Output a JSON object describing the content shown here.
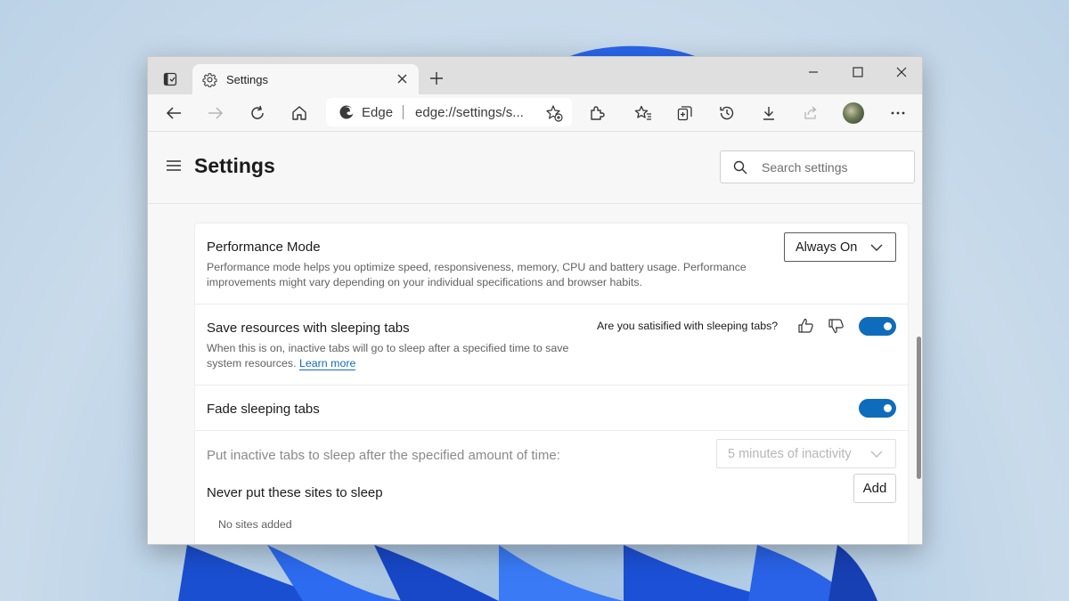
{
  "window": {
    "tab_title": "Settings",
    "controls": {
      "minimize": "minimize-icon",
      "maximize": "maximize-icon",
      "close": "close-icon"
    }
  },
  "toolbar": {
    "address": {
      "site_label": "Edge",
      "url": "edge://settings/s..."
    }
  },
  "settings": {
    "page_title": "Settings",
    "search_placeholder": "Search settings"
  },
  "performance_mode": {
    "title": "Performance Mode",
    "description_line1": "Performance mode helps you optimize speed, responsiveness, memory, CPU and battery usage. Performance",
    "description_line2": "improvements might vary depending on your individual specifications and browser habits.",
    "selected_option": "Always On"
  },
  "sleeping_tabs": {
    "title": "Save resources with sleeping tabs",
    "description_line1": "When this is on, inactive tabs will go to sleep after a specified time to save",
    "description_line2_prefix": "system resources.",
    "learn_more": "Learn more",
    "feedback_question": "Are you satisified with sleeping tabs?",
    "enabled": true
  },
  "fade_tabs": {
    "title": "Fade sleeping tabs",
    "enabled": true
  },
  "sleep_after": {
    "label": "Put inactive tabs to sleep after the specified amount of time:",
    "selected_option": "5 minutes of inactivity"
  },
  "never_sleep": {
    "title": "Never put these sites to sleep",
    "add_label": "Add",
    "empty_text": "No sites added"
  },
  "colors": {
    "accent": "#0f6cbd",
    "window_bg": "#f7f7f7",
    "titlebar_bg": "#dfdfdf"
  }
}
